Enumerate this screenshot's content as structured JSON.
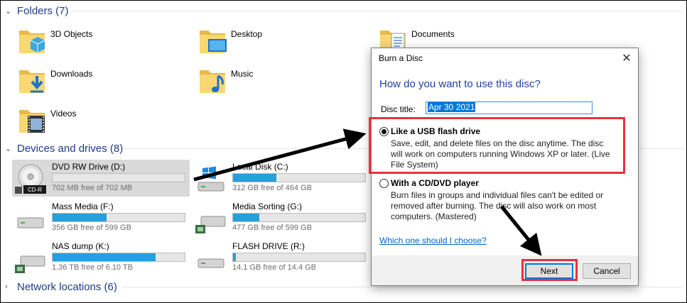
{
  "sections": {
    "folders": "Folders (7)",
    "devices": "Devices and drives (8)",
    "network": "Network locations (6)"
  },
  "folders": [
    {
      "label": "3D Objects",
      "icon": "3d-objects-folder-icon"
    },
    {
      "label": "Desktop",
      "icon": "desktop-folder-icon"
    },
    {
      "label": "Documents",
      "icon": "documents-folder-icon"
    },
    {
      "label": "Downloads",
      "icon": "downloads-folder-icon"
    },
    {
      "label": "Music",
      "icon": "music-folder-icon"
    },
    {
      "label": "Videos",
      "icon": "videos-folder-icon"
    }
  ],
  "drives": [
    {
      "name": "DVD RW Drive (D:)",
      "free": "702 MB free of 702 MB",
      "used_fraction": 0.0,
      "icon": "cd-r-disc-icon",
      "badge": "CD-R",
      "selected": true
    },
    {
      "name": "Local Disk (C:)",
      "free": "312 GB free of 464 GB",
      "used_fraction": 0.33,
      "icon": "windows-drive-icon"
    },
    {
      "name": "Mass Media (F:)",
      "free": "356 GB free of 599 GB",
      "used_fraction": 0.41,
      "icon": "hard-drive-icon"
    },
    {
      "name": "Media Sorting (G:)",
      "free": "477 GB free of 599 GB",
      "used_fraction": 0.2,
      "icon": "network-drive-icon"
    },
    {
      "name": "NAS dump (K:)",
      "free": "1.36 TB free of 6.10 TB",
      "used_fraction": 0.78,
      "icon": "network-drive-icon"
    },
    {
      "name": "FLASH DRIVE (R:)",
      "free": "14.1 GB free of 14.4 GB",
      "used_fraction": 0.02,
      "icon": "usb-drive-icon"
    }
  ],
  "dialog": {
    "title": "Burn a Disc",
    "heading": "How do you want to use this disc?",
    "disc_title_label": "Disc title:",
    "disc_title_value": "Apr 30 2021",
    "option1": {
      "title": "Like a USB flash drive",
      "desc": "Save, edit, and delete files on the disc anytime. The disc will work on computers running Windows XP or later. (Live File System)",
      "selected": true
    },
    "option2": {
      "title": "With a CD/DVD player",
      "desc": "Burn files in groups and individual files can't be edited or removed after burning. The disc will also work on most computers. (Mastered)",
      "selected": false
    },
    "help_link": "Which one should I choose?",
    "next_label": "Next",
    "cancel_label": "Cancel"
  },
  "colors": {
    "accent": "#26a0da",
    "highlight": "#e8323c",
    "heading_blue": "#1e3f9e"
  }
}
